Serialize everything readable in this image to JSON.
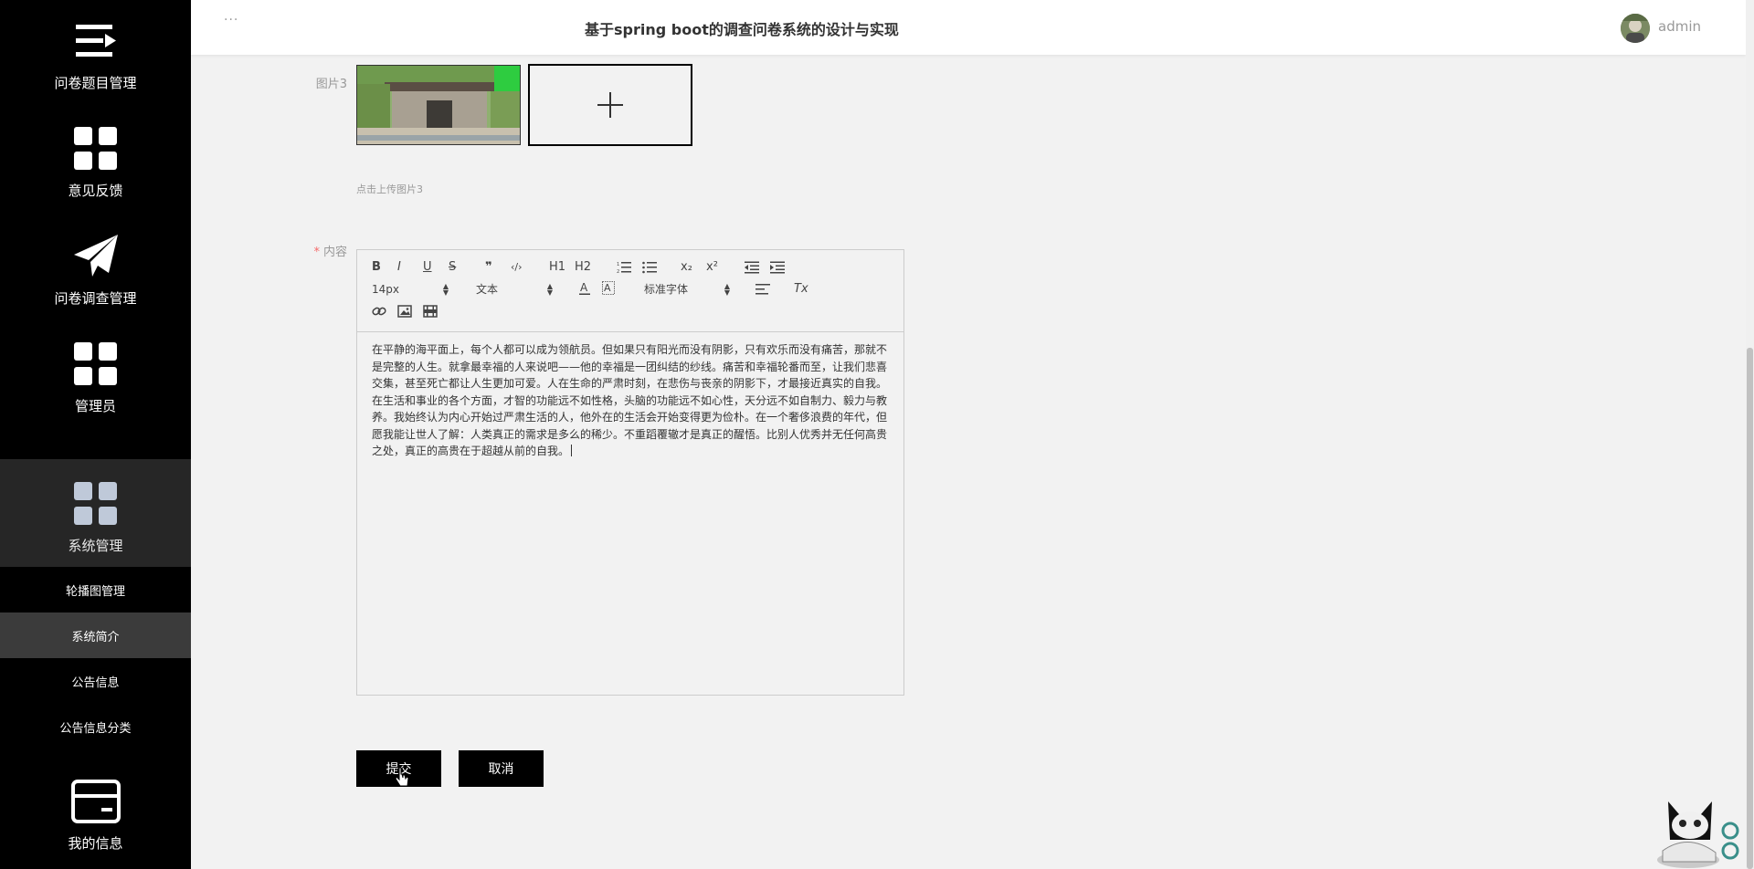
{
  "header": {
    "more": "···",
    "title": "基于spring boot的调查问卷系统的设计与实现",
    "user": "admin"
  },
  "sidebar": {
    "items": [
      {
        "label": "问卷题目管理",
        "icon": "menu-arrow-icon"
      },
      {
        "label": "意见反馈",
        "icon": "grid-icon"
      },
      {
        "label": "问卷调查管理",
        "icon": "paper-plane-icon"
      },
      {
        "label": "管理员",
        "icon": "grid-icon"
      },
      {
        "label": "系统管理",
        "icon": "grid-icon"
      },
      {
        "label": "我的信息",
        "icon": "card-icon"
      }
    ],
    "subitems": [
      "轮播图管理",
      "系统简介",
      "公告信息",
      "公告信息分类"
    ]
  },
  "form": {
    "image3_label": "图片3",
    "upload_hint": "点击上传图片3",
    "content_label": "内容",
    "required_mark": "*",
    "toolbar": {
      "bold": "B",
      "italic": "I",
      "underline": "U",
      "strike": "S",
      "quote": "❞",
      "code": "‹/›",
      "h1": "H1",
      "h2": "H2",
      "subscript": "x₂",
      "superscript": "x²",
      "size": "14px",
      "header_select": "文本",
      "font_select": "标准字体",
      "clean": "Tx"
    },
    "content_text": "在平静的海平面上，每个人都可以成为领航员。但如果只有阳光而没有阴影，只有欢乐而没有痛苦，那就不是完整的人生。就拿最幸福的人来说吧——他的幸福是一团纠结的纱线。痛苦和幸福轮番而至，让我们悲喜交集，甚至死亡都让人生更加可爱。人在生命的严肃时刻，在悲伤与丧亲的阴影下，才最接近真实的自我。在生活和事业的各个方面，才智的功能远不如性格，头脑的功能远不如心性，天分远不如自制力、毅力与教养。我始终认为内心开始过严肃生活的人，他外在的生活会开始变得更为俭朴。在一个奢侈浪费的年代，但愿我能让世人了解：人类真正的需求是多么的稀少。不重蹈覆辙才是真正的醒悟。比别人优秀并无任何高贵之处，真正的高贵在于超越从前的自我。",
    "submit": "提交",
    "cancel": "取消"
  },
  "colors": {
    "sidebar_bg": "#000000",
    "active_bg": "#262626",
    "sub_active_bg": "#3b3b3b",
    "required": "#f56c6c"
  }
}
